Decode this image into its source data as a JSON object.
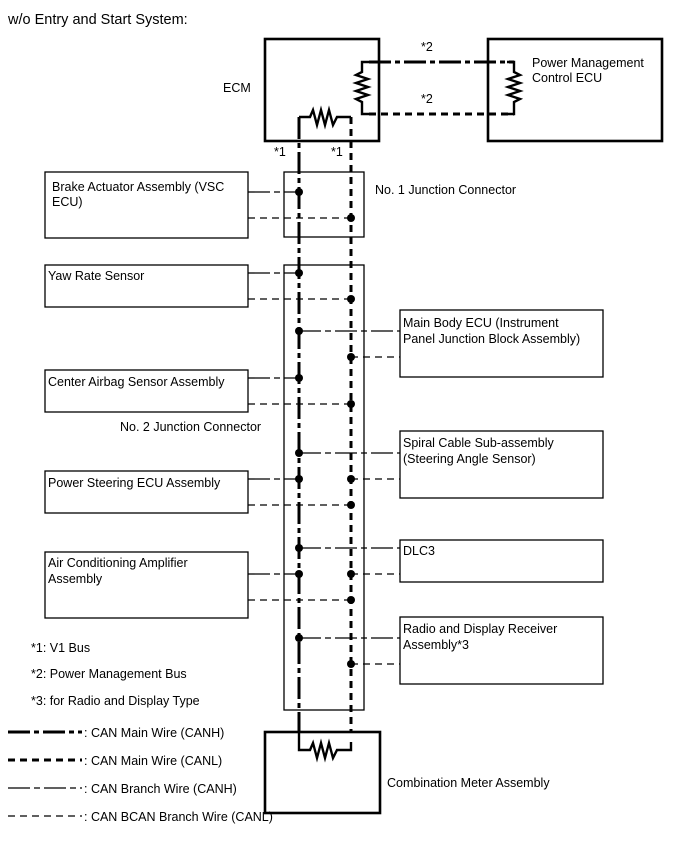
{
  "title": "w/o Entry and Start System:",
  "components": {
    "ecm": "ECM",
    "pmc_ecu": [
      "Power Management",
      "Control ECU"
    ],
    "jc1": "No. 1 Junction Connector",
    "jc2": "No. 2 Junction Connector",
    "brake": [
      "Brake Actuator Assembly (VSC",
      "ECU)"
    ],
    "yaw": "Yaw Rate Sensor",
    "airbag": "Center Airbag Sensor Assembly",
    "steering": "Power Steering ECU Assembly",
    "aircon": [
      "Air Conditioning Amplifier",
      "Assembly"
    ],
    "mainbody": [
      "Main Body ECU (Instrument",
      "Panel Junction Block Assembly)"
    ],
    "spiral": [
      "Spiral Cable Sub-assembly",
      "(Steering Angle Sensor)"
    ],
    "dlc3": "DLC3",
    "radio": [
      "Radio and Display Receiver",
      "Assembly*3"
    ],
    "meter": "Combination Meter Assembly"
  },
  "bus_marks": {
    "v1": "*1",
    "pm": "*2"
  },
  "notes": [
    "*1: V1 Bus",
    "*2: Power Management Bus",
    "*3: for Radio and Display Type"
  ],
  "legend": [
    {
      "style": "main-canh",
      "label": ": CAN Main Wire (CANH)"
    },
    {
      "style": "main-canl",
      "label": ": CAN Main Wire (CANL)"
    },
    {
      "style": "branch-canh",
      "label": ": CAN Branch Wire (CANH)"
    },
    {
      "style": "branch-canl",
      "label": ": CAN BCAN Branch Wire (CANL)"
    }
  ]
}
